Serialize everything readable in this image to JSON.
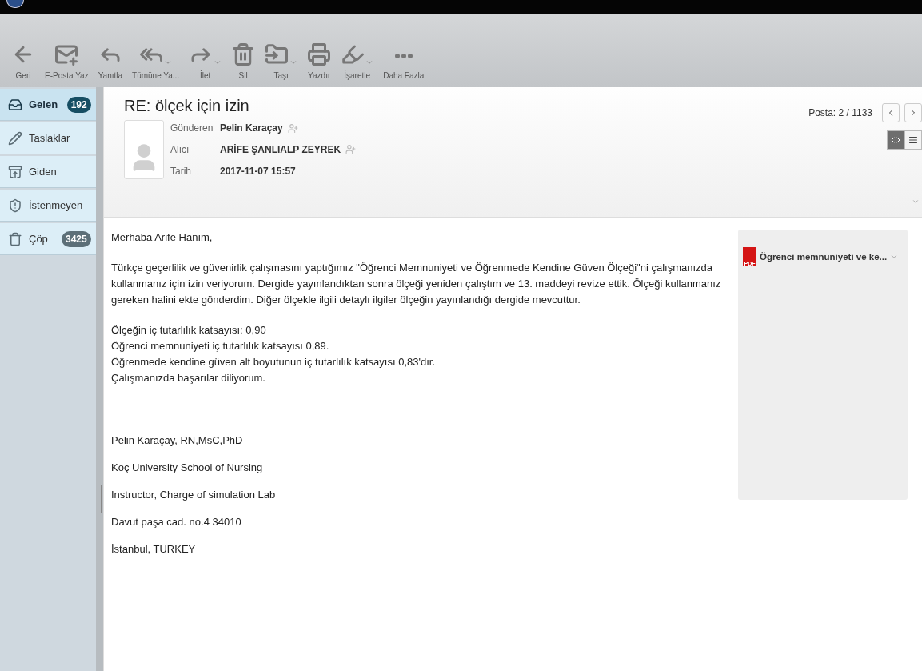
{
  "toolbar": [
    {
      "label": "Geri",
      "dropdown": false
    },
    {
      "label": "E-Posta Yaz",
      "dropdown": false
    },
    {
      "label": "Yanıtla",
      "dropdown": false
    },
    {
      "label": "Tümüne Ya...",
      "dropdown": true
    },
    {
      "label": "İlet",
      "dropdown": true
    },
    {
      "label": "Sil",
      "dropdown": false
    },
    {
      "label": "Taşı",
      "dropdown": true
    },
    {
      "label": "Yazdır",
      "dropdown": false
    },
    {
      "label": "İşaretle",
      "dropdown": true
    },
    {
      "label": "Daha Fazla",
      "dropdown": false
    }
  ],
  "sidebar": {
    "items": [
      {
        "label": "Gelen",
        "badge": "192",
        "selected": true
      },
      {
        "label": "Taslaklar",
        "selected": false
      },
      {
        "label": "Giden",
        "selected": false
      },
      {
        "label": "İstenmeyen",
        "selected": false
      },
      {
        "label": "Çöp",
        "badge": "3425",
        "selected": false
      }
    ]
  },
  "message": {
    "subject": "RE: ölçek için izin",
    "pager": "Posta: 2 / 1133",
    "view_toggle": [
      {
        "selected": true
      },
      {
        "selected": false
      }
    ],
    "fields": [
      {
        "label": "Gönderen",
        "value": "Pelin Karaçay",
        "add_contact": true
      },
      {
        "label": "Alıcı",
        "value": "ARİFE ŞANLIALP ZEYREK",
        "add_contact": true
      },
      {
        "label": "Tarih",
        "value": "2017-11-07 15:57",
        "add_contact": false
      }
    ],
    "body": [
      [
        "Merhaba Arife Hanım,"
      ],
      [
        "Türkçe geçerlilik ve güvenirlik çalışmasını yaptığımız \"Öğrenci Memnuniyeti ve Öğrenmede Kendine Güven Ölçeği\"ni çalışmanızda kullanmanız için izin veriyorum. Dergide yayınlandıktan sonra ölçeği yeniden çalıştım ve 13. maddeyi revize ettik. Ölçeği kullanmanız gereken halini ekte gönderdim. Diğer ölçekle ilgili detaylı ilgiler ölçeğin yayınlandığı dergide mevcuttur."
      ],
      [
        "Ölçeğin iç tutarlılık katsayısı: 0,90",
        "Öğrenci memnuniyeti iç tutarlılık katsayısı 0,89.",
        "Öğrenmede kendine güven alt boyutunun  iç tutarlılık katsayısı 0,83'dır.",
        "Çalışmanızda başarılar diliyorum."
      ]
    ],
    "signature": [
      "Pelin Karaçay, RN,MsC,PhD",
      "Koç University School of Nursing",
      "Instructor, Charge of simulation Lab",
      "Davut paşa cad. no.4 34010",
      "İstanbul, TURKEY"
    ],
    "attachment": {
      "name": "Öğrenci memnuniyeti ve ke...",
      "icon_text": "PDF"
    }
  }
}
